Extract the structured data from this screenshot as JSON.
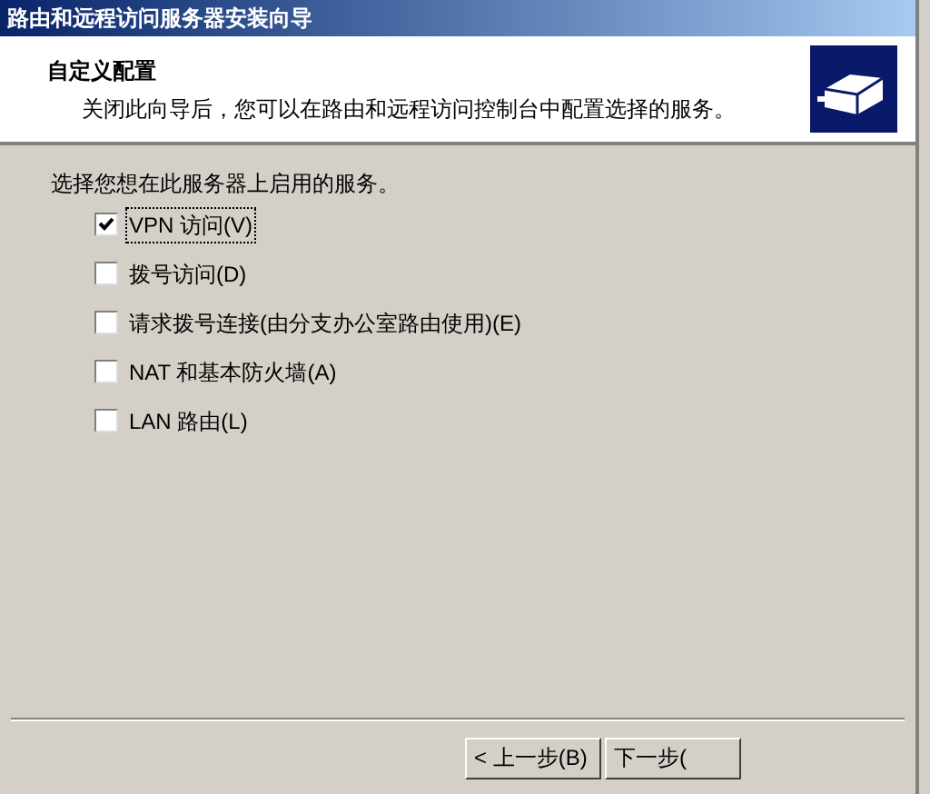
{
  "window": {
    "title": "路由和远程访问服务器安装向导"
  },
  "header": {
    "title": "自定义配置",
    "subtitle": "关闭此向导后，您可以在路由和远程访问控制台中配置选择的服务。"
  },
  "prompt": "选择您想在此服务器上启用的服务。",
  "options": [
    {
      "label": "VPN 访问(V)",
      "checked": true,
      "focused": true
    },
    {
      "label": "拨号访问(D)",
      "checked": false,
      "focused": false
    },
    {
      "label": "请求拨号连接(由分支办公室路由使用)(E)",
      "checked": false,
      "focused": false
    },
    {
      "label": "NAT 和基本防火墙(A)",
      "checked": false,
      "focused": false
    },
    {
      "label": "LAN 路由(L)",
      "checked": false,
      "focused": false
    }
  ],
  "buttons": [
    {
      "label": "< 上一步(B)"
    },
    {
      "label": "下一步("
    }
  ]
}
